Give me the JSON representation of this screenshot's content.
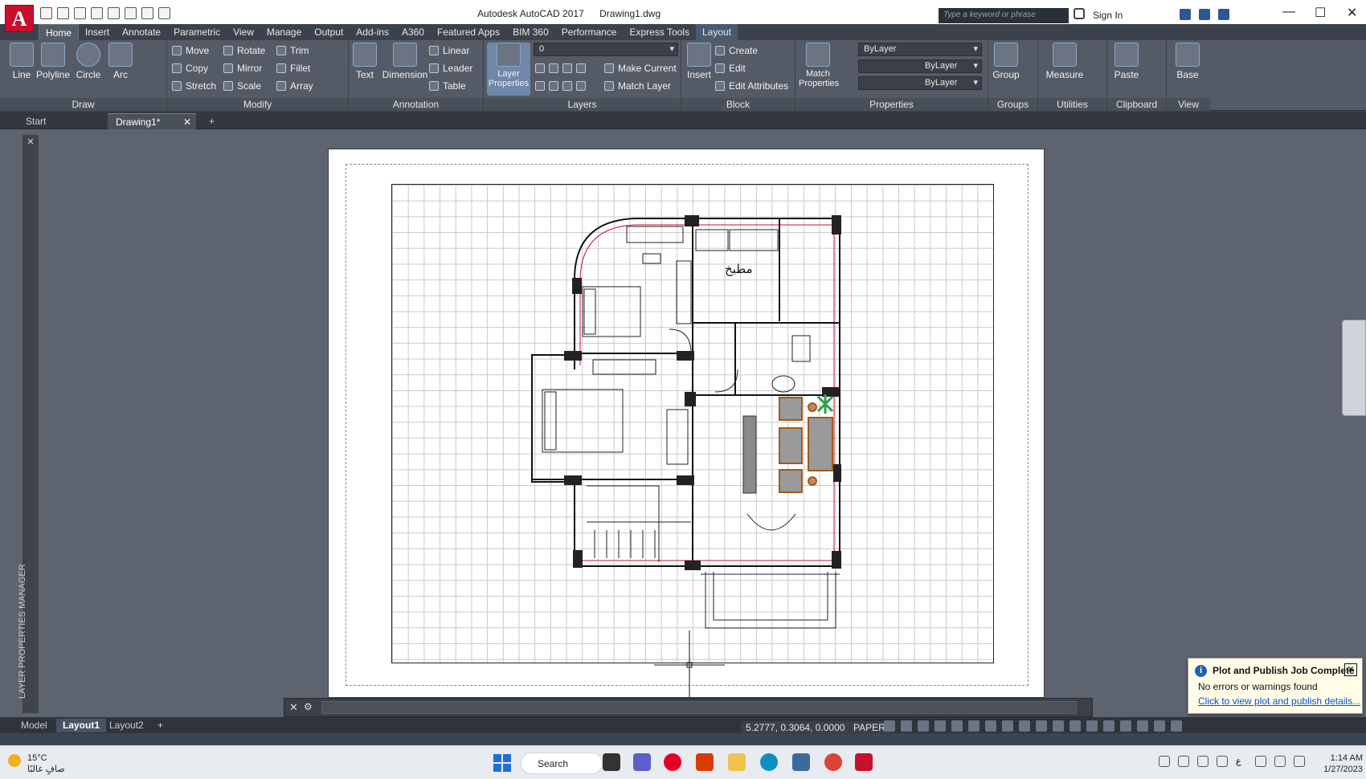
{
  "titlebar": {
    "app_letter": "A",
    "app_name": "Autodesk AutoCAD 2017",
    "file": "Drawing1.dwg",
    "search_placeholder": "Type a keyword or phrase",
    "sign_in": "Sign In"
  },
  "ribbon_tabs": [
    "Home",
    "Insert",
    "Annotate",
    "Parametric",
    "View",
    "Manage",
    "Output",
    "Add-ins",
    "A360",
    "Featured Apps",
    "BIM 360",
    "Performance",
    "Express Tools",
    "Layout"
  ],
  "draw": {
    "line": "Line",
    "polyline": "Polyline",
    "circle": "Circle",
    "arc": "Arc",
    "title": "Draw"
  },
  "modify": {
    "move": "Move",
    "rotate": "Rotate",
    "trim": "Trim",
    "copy": "Copy",
    "mirror": "Mirror",
    "fillet": "Fillet",
    "stretch": "Stretch",
    "scale": "Scale",
    "array": "Array",
    "title": "Modify"
  },
  "annotation": {
    "text": "Text",
    "dimension": "Dimension",
    "linear": "Linear",
    "leader": "Leader",
    "table": "Table",
    "title": "Annotation"
  },
  "layers": {
    "layer_properties": "Layer Properties",
    "current_layer": "0",
    "make_current": "Make Current",
    "match_layer": "Match Layer",
    "title": "Layers"
  },
  "block": {
    "insert": "Insert",
    "create": "Create",
    "edit": "Edit",
    "edit_attributes": "Edit Attributes",
    "title": "Block"
  },
  "properties": {
    "match": "Match Properties",
    "color": "ByLayer",
    "linetype": "ByLayer",
    "lineweight": "ByLayer",
    "title": "Properties"
  },
  "groups": {
    "group": "Group",
    "title": "Groups"
  },
  "utilities": {
    "measure": "Measure",
    "title": "Utilities"
  },
  "clipboard": {
    "paste": "Paste",
    "title": "Clipboard"
  },
  "view": {
    "base": "Base",
    "title": "View"
  },
  "doc_tabs": {
    "start": "Start",
    "drawing": "Drawing1*"
  },
  "drawing": {
    "kitchen_label": "مطبخ"
  },
  "layer_manager_label": "LAYER PROPERTIES MANAGER",
  "layout_tabs": [
    "Model",
    "Layout1",
    "Layout2"
  ],
  "status": {
    "coords": "5.2777, 0.3064, 0.0000",
    "space": "PAPER"
  },
  "notification": {
    "title": "Plot and Publish Job Complete",
    "message": "No errors or warnings found",
    "link": "Click to view plot and publish details..."
  },
  "taskbar": {
    "temp": "15°C",
    "weather": "صافٍ غالبًا",
    "search": "Search",
    "time": "1:14 AM",
    "date": "1/27/2023",
    "lang": "ع"
  }
}
